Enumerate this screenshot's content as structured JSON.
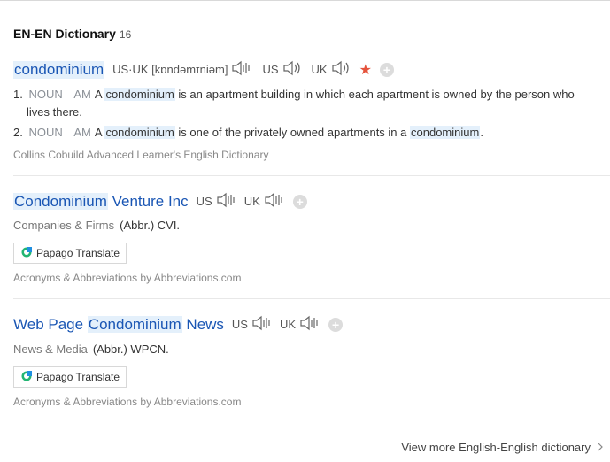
{
  "header": {
    "title": "EN-EN Dictionary",
    "count": "16"
  },
  "entry1": {
    "headword": "condominium",
    "pron_label": "US·UK [kɒndəmɪniəm]",
    "us_label": "US",
    "uk_label": "UK",
    "defs": [
      {
        "num": "1.",
        "pos": "NOUN",
        "tag": "AM",
        "pre": "A ",
        "word": "condominium",
        "post": " is an apartment building in which each apartment is owned by the person who",
        "cont": "lives there."
      },
      {
        "num": "2.",
        "pos": "NOUN",
        "tag": "AM",
        "pre": "A ",
        "word": "condominium",
        "mid": " is one of the privately owned apartments in a ",
        "word2": "condominium",
        "end": "."
      }
    ],
    "source": "Collins Cobuild Advanced Learner's English Dictionary"
  },
  "entry2": {
    "head_hl": "Condominium",
    "head_rest": " Venture Inc",
    "us_label": "US",
    "uk_label": "UK",
    "category": "Companies & Firms",
    "abbr": "(Abbr.) CVI.",
    "translate_label": "Papago Translate",
    "source": "Acronyms & Abbreviations by Abbreviations.com"
  },
  "entry3": {
    "head_pre": "Web Page ",
    "head_hl": "Condominium",
    "head_rest": " News",
    "us_label": "US",
    "uk_label": "UK",
    "category": "News & Media",
    "abbr": "(Abbr.) WPCN.",
    "translate_label": "Papago Translate",
    "source": "Acronyms & Abbreviations by Abbreviations.com"
  },
  "footer": {
    "more_label": "View more English-English dictionary"
  }
}
